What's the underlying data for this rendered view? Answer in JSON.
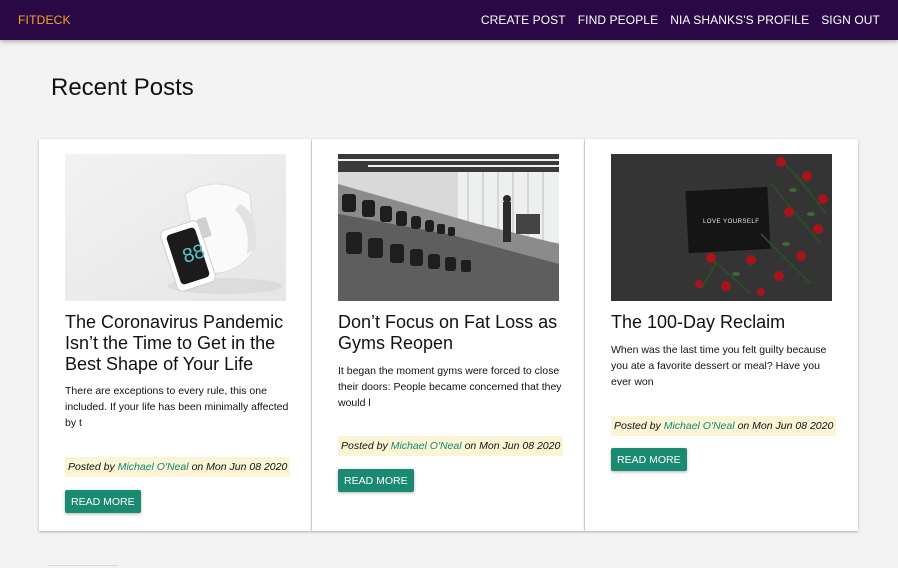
{
  "navbar": {
    "brand": "FITDECK",
    "links": [
      "CREATE POST",
      "FIND PEOPLE",
      "NIA SHANKS'S PROFILE",
      "SIGN OUT"
    ]
  },
  "page": {
    "title": "Recent Posts"
  },
  "posts": [
    {
      "image": "smartwatch-photo",
      "title": "The Coronavirus Pandemic Isn’t the Time to Get in the Best Shape of Your Life",
      "excerpt": "There are exceptions to every rule, this one included. If your life has been minimally affected by t",
      "posted_by_prefix": "Posted by",
      "author": "Michael O'Neal",
      "date_text": "on Mon Jun 08 2020",
      "button": "READ MORE"
    },
    {
      "image": "gym-dumbbells-photo",
      "title": "Don’t Focus on Fat Loss as Gyms Reopen",
      "excerpt": "It began the moment gyms were forced to close their doors: People became concerned that they would l",
      "posted_by_prefix": "Posted by",
      "author": "Michael O'Neal",
      "date_text": "on Mon Jun 08 2020",
      "button": "READ MORE"
    },
    {
      "image": "roses-love-yourself-photo",
      "image_text": "LOVE YOURSELF",
      "title": "The 100-Day Reclaim",
      "excerpt": "When was the last time you felt guilty because you ate a favorite dessert or meal? Have you ever won",
      "posted_by_prefix": "Posted by",
      "author": "Michael O'Neal",
      "date_text": "on Mon Jun 08 2020",
      "button": "READ MORE"
    }
  ],
  "colors": {
    "navbar": "#2a0845",
    "brand": "#f5a623",
    "button": "#1a8a72",
    "author_link": "#118a73",
    "meta_highlight": "#fbf5d6"
  }
}
